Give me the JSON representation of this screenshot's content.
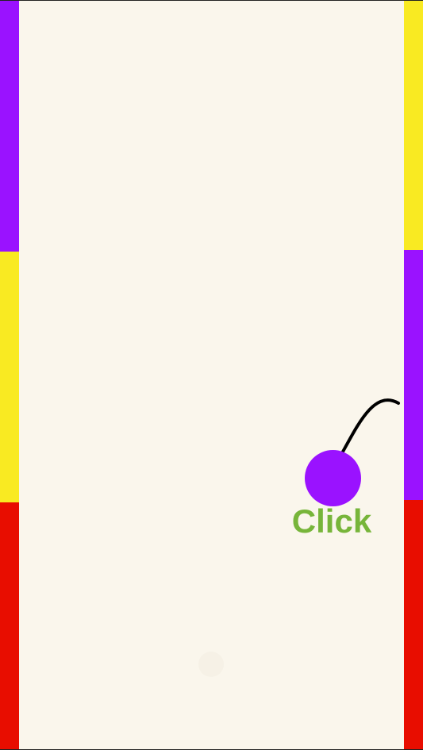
{
  "colors": {
    "background": "#faf6ec",
    "purple": "#9a12ff",
    "yellow": "#f9ea22",
    "red": "#e80d00",
    "hint_text": "#77b53a",
    "trail": "#000000"
  },
  "walls": {
    "left": [
      {
        "color": "purple"
      },
      {
        "color": "yellow"
      },
      {
        "color": "red"
      }
    ],
    "right": [
      {
        "color": "yellow"
      },
      {
        "color": "purple"
      },
      {
        "color": "red"
      }
    ]
  },
  "ball": {
    "color": "purple"
  },
  "hint": {
    "label": "Click"
  },
  "icons": {
    "ghost_mark": "pacman-ghost-icon"
  }
}
